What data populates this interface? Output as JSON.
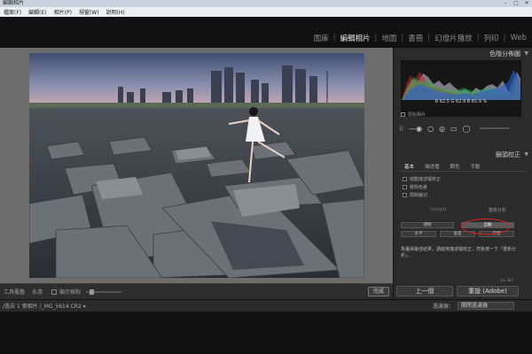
{
  "window": {
    "title": "編輯相片",
    "buttons": [
      "–",
      "▢",
      "✕"
    ]
  },
  "menu": [
    "檔案(F)",
    "編輯(E)",
    "相片(P)",
    "視窗(W)",
    "說明(H)"
  ],
  "modules": [
    {
      "label": "圖庫",
      "active": false
    },
    {
      "label": "編輯相片",
      "active": true
    },
    {
      "label": "地圖",
      "active": false
    },
    {
      "label": "書冊",
      "active": false
    },
    {
      "label": "幻燈片播放",
      "active": false
    },
    {
      "label": "列印",
      "active": false
    },
    {
      "label": "Web",
      "active": false
    }
  ],
  "toolbar": {
    "tool_label": "工具覆疊",
    "tool_value": "永遠",
    "checkbox_label": "顯示格點",
    "done_label": "完成"
  },
  "histogram": {
    "title": "色階分佈圖",
    "readout": "R 62.5  G 62.9  B 65.9 %",
    "show_original": "原始相片"
  },
  "lens": {
    "title": "鏡頭校正",
    "tabs": [
      {
        "label": "基本",
        "active": true
      },
      {
        "label": "描述檔",
        "active": false
      },
      {
        "label": "顏色",
        "active": false
      },
      {
        "label": "手動",
        "active": false
      }
    ],
    "options": [
      "啟動描述檔校正",
      "移除色差",
      "限制裁切"
    ],
    "upright_label": "Upright",
    "reanalyze_label": "重新分析",
    "upright_row1": [
      {
        "label": "關閉",
        "on": false
      },
      {
        "label": "自動",
        "on": true
      }
    ],
    "upright_row2": [
      {
        "label": "水平",
        "on": false
      },
      {
        "label": "垂直",
        "on": false
      },
      {
        "label": "完整",
        "on": false
      }
    ],
    "message": "為獲得最佳結果，請啟用描述檔校正，然後按一下「重新分析」。",
    "footer": "n/a 387"
  },
  "buttons": {
    "previous": "上一個",
    "reset": "重設 (Adobe)"
  },
  "filmstrip": {
    "path": "/過去 1 張相片 /_MG_5614.CR2 ▾",
    "filter_label": "過濾器：",
    "filter_value": "關閉過濾器"
  },
  "colors": {
    "accent_circle": "#e01e1e",
    "panel_bg": "#2b2b2b",
    "content_bg": "#6d6d6d"
  }
}
